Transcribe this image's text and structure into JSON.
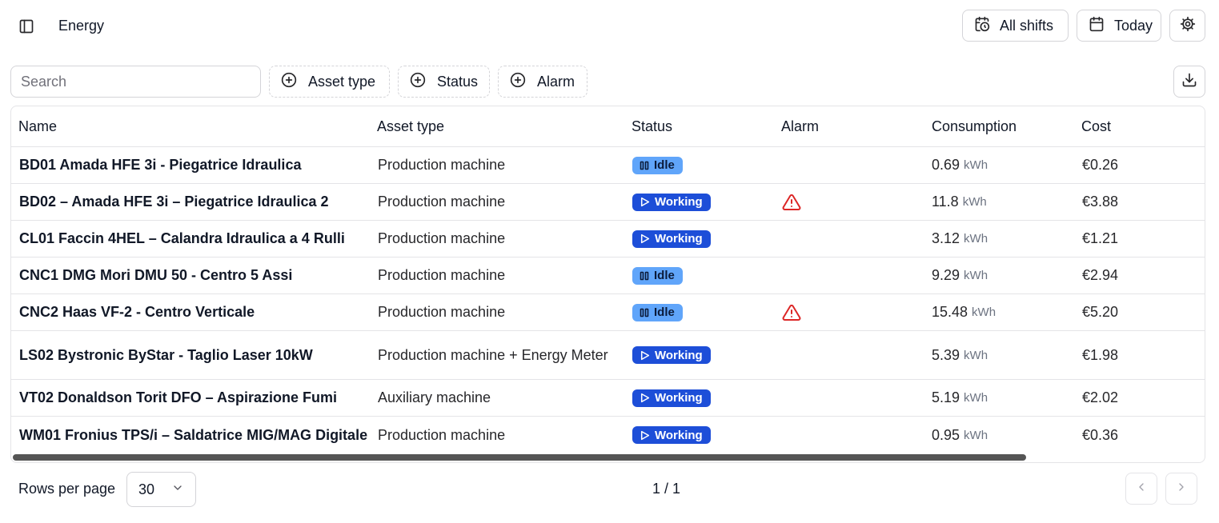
{
  "header": {
    "title": "Energy",
    "shifts_label": "All shifts",
    "date_label": "Today"
  },
  "toolbar": {
    "search_placeholder": "Search",
    "filters": {
      "asset_type": "Asset type",
      "status": "Status",
      "alarm": "Alarm"
    }
  },
  "table": {
    "columns": {
      "name": "Name",
      "asset_type": "Asset type",
      "status": "Status",
      "alarm": "Alarm",
      "consumption": "Consumption",
      "cost": "Cost"
    },
    "consumption_unit": "kWh",
    "rows": [
      {
        "name": "BD01 Amada HFE 3i - Piegatrice Idraulica",
        "asset_type": "Production machine",
        "status": "Idle",
        "alarm": false,
        "consumption": "0.69",
        "cost": "€0.26"
      },
      {
        "name": "BD02 – Amada HFE 3i – Piegatrice Idraulica 2",
        "asset_type": "Production machine",
        "status": "Working",
        "alarm": true,
        "consumption": "11.8",
        "cost": "€3.88"
      },
      {
        "name": "CL01 Faccin 4HEL – Calandra Idraulica a 4 Rulli",
        "asset_type": "Production machine",
        "status": "Working",
        "alarm": false,
        "consumption": "3.12",
        "cost": "€1.21"
      },
      {
        "name": "CNC1 DMG Mori DMU 50 - Centro 5 Assi",
        "asset_type": "Production machine",
        "status": "Idle",
        "alarm": false,
        "consumption": "9.29",
        "cost": "€2.94"
      },
      {
        "name": "CNC2 Haas VF-2 - Centro Verticale",
        "asset_type": "Production machine",
        "status": "Idle",
        "alarm": true,
        "consumption": "15.48",
        "cost": "€5.20"
      },
      {
        "name": "LS02 Bystronic ByStar - Taglio Laser 10kW",
        "asset_type": "Production machine + Energy Meter",
        "status": "Working",
        "alarm": false,
        "consumption": "5.39",
        "cost": "€1.98"
      },
      {
        "name": "VT02 Donaldson Torit DFO – Aspirazione Fumi",
        "asset_type": "Auxiliary machine",
        "status": "Working",
        "alarm": false,
        "consumption": "5.19",
        "cost": "€2.02"
      },
      {
        "name": "WM01 Fronius TPS/i – Saldatrice MIG/MAG Digitale",
        "asset_type": "Production machine",
        "status": "Working",
        "alarm": false,
        "consumption": "0.95",
        "cost": "€0.36"
      }
    ]
  },
  "footer": {
    "rows_per_page_label": "Rows per page",
    "rows_per_page_value": "30",
    "page_indicator": "1 / 1"
  },
  "colors": {
    "idle_badge": "#60a5fa",
    "working_badge": "#1d4ed8",
    "alarm_icon": "#dc2626",
    "border": "#e4e4e7"
  },
  "icons": {
    "sidebar_toggle": "sidebar-panel-icon",
    "shifts": "calendar-clock-icon",
    "date": "calendar-icon",
    "settings": "gear-icon",
    "filter_add": "plus-circle-icon",
    "download": "download-icon",
    "idle": "pause-icon",
    "working": "play-icon",
    "alarm": "warning-triangle-icon",
    "rows_per_page": "chevron-down-icon",
    "prev": "chevron-left-icon",
    "next": "chevron-right-icon"
  }
}
